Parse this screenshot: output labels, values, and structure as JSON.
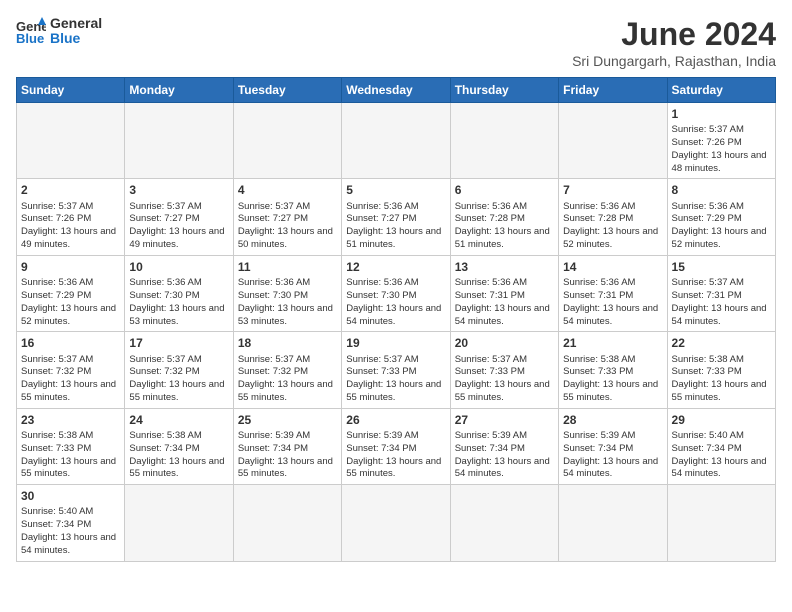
{
  "logo": {
    "text_general": "General",
    "text_blue": "Blue"
  },
  "title": "June 2024",
  "subtitle": "Sri Dungargarh, Rajasthan, India",
  "days_of_week": [
    "Sunday",
    "Monday",
    "Tuesday",
    "Wednesday",
    "Thursday",
    "Friday",
    "Saturday"
  ],
  "weeks": [
    [
      {
        "day": "",
        "empty": true
      },
      {
        "day": "",
        "empty": true
      },
      {
        "day": "",
        "empty": true
      },
      {
        "day": "",
        "empty": true
      },
      {
        "day": "",
        "empty": true
      },
      {
        "day": "",
        "empty": true
      },
      {
        "day": "1",
        "sunrise": "5:37 AM",
        "sunset": "7:26 PM",
        "daylight": "13 hours and 48 minutes."
      }
    ],
    [
      {
        "day": "2",
        "sunrise": "5:37 AM",
        "sunset": "7:26 PM",
        "daylight": "13 hours and 49 minutes."
      },
      {
        "day": "3",
        "sunrise": "5:37 AM",
        "sunset": "7:27 PM",
        "daylight": "13 hours and 49 minutes."
      },
      {
        "day": "4",
        "sunrise": "5:37 AM",
        "sunset": "7:27 PM",
        "daylight": "13 hours and 50 minutes."
      },
      {
        "day": "5",
        "sunrise": "5:36 AM",
        "sunset": "7:27 PM",
        "daylight": "13 hours and 51 minutes."
      },
      {
        "day": "6",
        "sunrise": "5:36 AM",
        "sunset": "7:28 PM",
        "daylight": "13 hours and 51 minutes."
      },
      {
        "day": "7",
        "sunrise": "5:36 AM",
        "sunset": "7:28 PM",
        "daylight": "13 hours and 52 minutes."
      },
      {
        "day": "8",
        "sunrise": "5:36 AM",
        "sunset": "7:29 PM",
        "daylight": "13 hours and 52 minutes."
      }
    ],
    [
      {
        "day": "9",
        "sunrise": "5:36 AM",
        "sunset": "7:29 PM",
        "daylight": "13 hours and 52 minutes."
      },
      {
        "day": "10",
        "sunrise": "5:36 AM",
        "sunset": "7:30 PM",
        "daylight": "13 hours and 53 minutes."
      },
      {
        "day": "11",
        "sunrise": "5:36 AM",
        "sunset": "7:30 PM",
        "daylight": "13 hours and 53 minutes."
      },
      {
        "day": "12",
        "sunrise": "5:36 AM",
        "sunset": "7:30 PM",
        "daylight": "13 hours and 54 minutes."
      },
      {
        "day": "13",
        "sunrise": "5:36 AM",
        "sunset": "7:31 PM",
        "daylight": "13 hours and 54 minutes."
      },
      {
        "day": "14",
        "sunrise": "5:36 AM",
        "sunset": "7:31 PM",
        "daylight": "13 hours and 54 minutes."
      },
      {
        "day": "15",
        "sunrise": "5:37 AM",
        "sunset": "7:31 PM",
        "daylight": "13 hours and 54 minutes."
      }
    ],
    [
      {
        "day": "16",
        "sunrise": "5:37 AM",
        "sunset": "7:32 PM",
        "daylight": "13 hours and 55 minutes."
      },
      {
        "day": "17",
        "sunrise": "5:37 AM",
        "sunset": "7:32 PM",
        "daylight": "13 hours and 55 minutes."
      },
      {
        "day": "18",
        "sunrise": "5:37 AM",
        "sunset": "7:32 PM",
        "daylight": "13 hours and 55 minutes."
      },
      {
        "day": "19",
        "sunrise": "5:37 AM",
        "sunset": "7:33 PM",
        "daylight": "13 hours and 55 minutes."
      },
      {
        "day": "20",
        "sunrise": "5:37 AM",
        "sunset": "7:33 PM",
        "daylight": "13 hours and 55 minutes."
      },
      {
        "day": "21",
        "sunrise": "5:38 AM",
        "sunset": "7:33 PM",
        "daylight": "13 hours and 55 minutes."
      },
      {
        "day": "22",
        "sunrise": "5:38 AM",
        "sunset": "7:33 PM",
        "daylight": "13 hours and 55 minutes."
      }
    ],
    [
      {
        "day": "23",
        "sunrise": "5:38 AM",
        "sunset": "7:33 PM",
        "daylight": "13 hours and 55 minutes."
      },
      {
        "day": "24",
        "sunrise": "5:38 AM",
        "sunset": "7:34 PM",
        "daylight": "13 hours and 55 minutes."
      },
      {
        "day": "25",
        "sunrise": "5:39 AM",
        "sunset": "7:34 PM",
        "daylight": "13 hours and 55 minutes."
      },
      {
        "day": "26",
        "sunrise": "5:39 AM",
        "sunset": "7:34 PM",
        "daylight": "13 hours and 55 minutes."
      },
      {
        "day": "27",
        "sunrise": "5:39 AM",
        "sunset": "7:34 PM",
        "daylight": "13 hours and 54 minutes."
      },
      {
        "day": "28",
        "sunrise": "5:39 AM",
        "sunset": "7:34 PM",
        "daylight": "13 hours and 54 minutes."
      },
      {
        "day": "29",
        "sunrise": "5:40 AM",
        "sunset": "7:34 PM",
        "daylight": "13 hours and 54 minutes."
      }
    ],
    [
      {
        "day": "30",
        "sunrise": "5:40 AM",
        "sunset": "7:34 PM",
        "daylight": "13 hours and 54 minutes."
      },
      {
        "day": "",
        "empty": true
      },
      {
        "day": "",
        "empty": true
      },
      {
        "day": "",
        "empty": true
      },
      {
        "day": "",
        "empty": true
      },
      {
        "day": "",
        "empty": true
      },
      {
        "day": "",
        "empty": true
      }
    ]
  ]
}
